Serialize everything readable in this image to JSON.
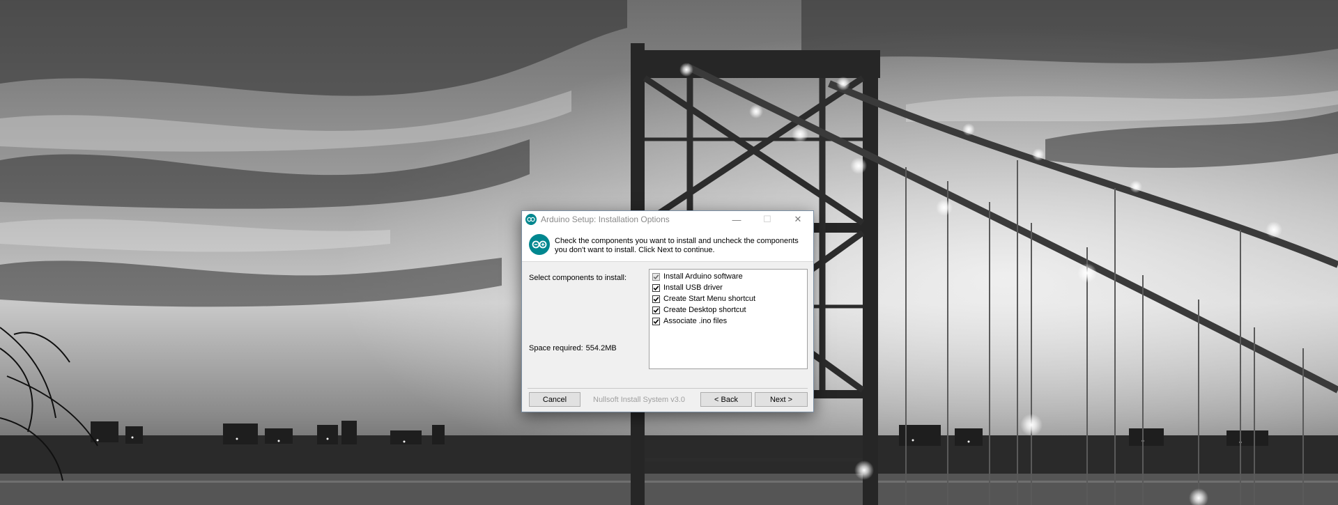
{
  "window": {
    "title": "Arduino Setup: Installation Options",
    "controls": {
      "minimize": "—",
      "maximize": "☐",
      "close": "✕"
    }
  },
  "header": {
    "instructions": "Check the components you want to install and uncheck the components you don't want to install. Click Next to continue.",
    "logo_icon": "arduino-infinity-icon"
  },
  "content": {
    "select_label": "Select components to install:",
    "space_label": "Space required:",
    "space_value": "554.2MB",
    "components": [
      {
        "label": "Install Arduino software",
        "checked": true,
        "disabled": true
      },
      {
        "label": "Install USB driver",
        "checked": true,
        "disabled": false
      },
      {
        "label": "Create Start Menu shortcut",
        "checked": true,
        "disabled": false
      },
      {
        "label": "Create Desktop shortcut",
        "checked": true,
        "disabled": false
      },
      {
        "label": "Associate .ino files",
        "checked": true,
        "disabled": false
      }
    ]
  },
  "footer": {
    "cancel_label": "Cancel",
    "brand": "Nullsoft Install System v3.0",
    "back_label": "< Back",
    "next_label": "Next >"
  },
  "colors": {
    "accent": "#00878f",
    "window_bg": "#f0f0f0"
  }
}
